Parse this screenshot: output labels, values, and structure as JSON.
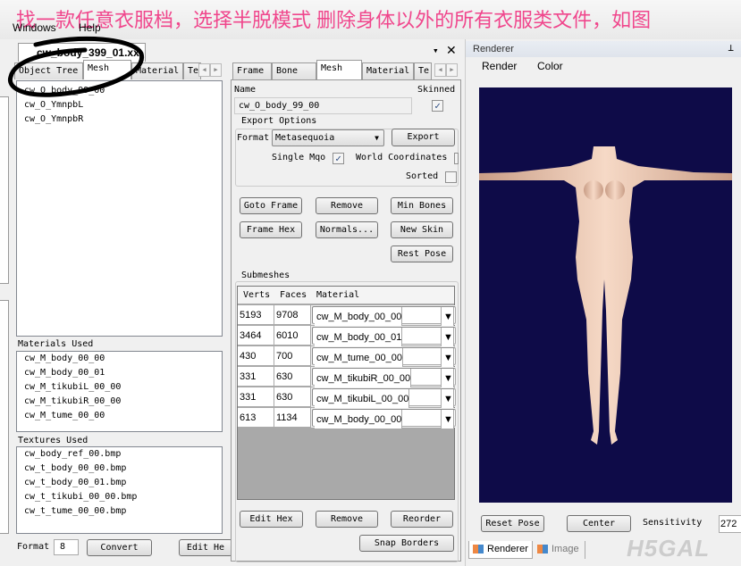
{
  "overlay_caption": "找一款任意衣服档，选择半脱模式 删除身体以外的所有衣服类文件，如图",
  "menu": {
    "windows": "Windows",
    "help": "Help"
  },
  "doc_tab": "cw_body_399_01.xx",
  "left": {
    "tabs": [
      "Object Tree",
      "Mesh",
      "Material",
      "Te"
    ],
    "active_tab": "Mesh",
    "meshes": [
      "cw_O_body_99_00",
      "cw_O_YmnpbL",
      "cw_O_YmnpbR"
    ],
    "materials_label": "Materials Used",
    "materials": [
      "cw_M_body_00_00",
      "cw_M_body_00_01",
      "cw_M_tikubiL_00_00",
      "cw_M_tikubiR_00_00",
      "cw_M_tume_00_00"
    ],
    "textures_label": "Textures Used",
    "textures": [
      "cw_body_ref_00.bmp",
      "cw_t_body_00_00.bmp",
      "cw_t_body_00_01.bmp",
      "cw_t_tikubi_00_00.bmp",
      "cw_t_tume_00_00.bmp"
    ],
    "format_label": "Format",
    "format_value": "8",
    "convert": "Convert",
    "edit_hex": "Edit He"
  },
  "mid": {
    "tabs": [
      "Frame",
      "Bone",
      "Mesh",
      "Material",
      "Te"
    ],
    "active_tab": "Mesh",
    "name_label": "Name",
    "name_value": "cw_O_body_99_00",
    "skinned_label": "Skinned",
    "skinned": true,
    "export_options": "Export Options",
    "format_label": "Format",
    "format_value": "Metasequoia",
    "export": "Export",
    "single_mqo": "Single Mqo",
    "single_mqo_checked": true,
    "world_coords": "World Coordinates",
    "world_coords_checked": false,
    "sorted": "Sorted",
    "sorted_checked": false,
    "buttons": [
      "Goto Frame",
      "Remove",
      "Min Bones",
      "Frame Hex",
      "Normals...",
      "New Skin",
      "Rest Pose"
    ],
    "submeshes_label": "Submeshes",
    "columns": [
      "Verts",
      "Faces",
      "Material"
    ],
    "rows": [
      {
        "verts": "5193",
        "faces": "9708",
        "material": "cw_M_body_00_00"
      },
      {
        "verts": "3464",
        "faces": "6010",
        "material": "cw_M_body_00_01"
      },
      {
        "verts": "430",
        "faces": "700",
        "material": "cw_M_tume_00_00"
      },
      {
        "verts": "331",
        "faces": "630",
        "material": "cw_M_tikubiR_00_00"
      },
      {
        "verts": "331",
        "faces": "630",
        "material": "cw_M_tikubiL_00_00"
      },
      {
        "verts": "613",
        "faces": "1134",
        "material": "cw_M_body_00_00"
      }
    ],
    "edit_hex": "Edit Hex",
    "remove": "Remove",
    "reorder": "Reorder",
    "snap_borders": "Snap Borders"
  },
  "renderer": {
    "title": "Renderer",
    "menu": [
      "Render",
      "Color"
    ],
    "viewport_bg": "#0e0b48",
    "reset_pose": "Reset Pose",
    "center": "Center",
    "sensitivity_label": "Sensitivity",
    "sensitivity_value": "272",
    "bottom_tabs": [
      "Renderer",
      "Image"
    ]
  },
  "watermark": "H5GAL"
}
